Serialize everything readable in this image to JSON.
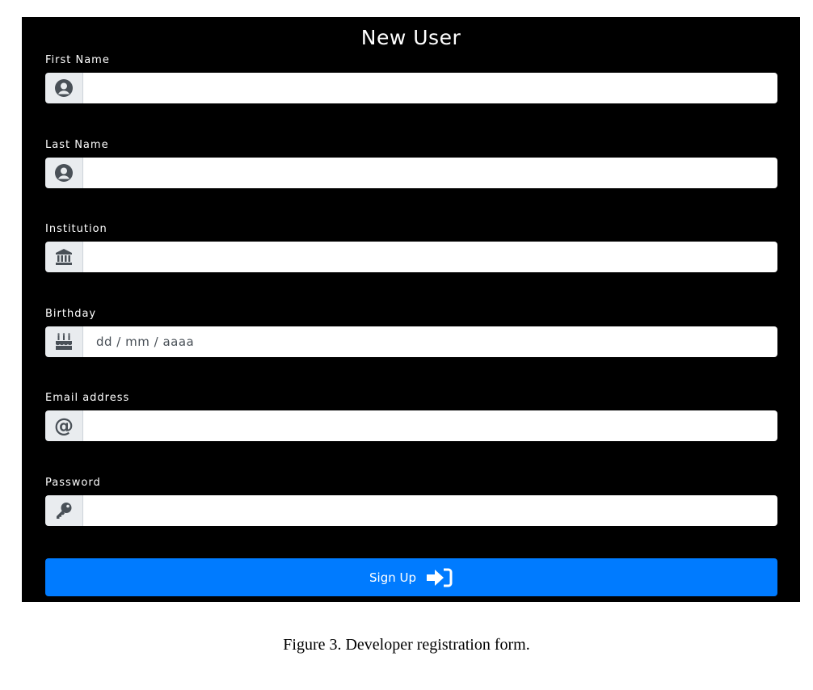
{
  "form": {
    "title": "New User",
    "fields": [
      {
        "label": "First Name",
        "icon": "user-circle-icon",
        "value": ""
      },
      {
        "label": "Last Name",
        "icon": "user-circle-icon",
        "value": ""
      },
      {
        "label": "Institution",
        "icon": "university-icon",
        "value": ""
      },
      {
        "label": "Birthday",
        "icon": "birthday-cake-icon",
        "value": "",
        "display": "dd / mm / aaaa"
      },
      {
        "label": "Email address",
        "icon": "at-icon",
        "value": ""
      },
      {
        "label": "Password",
        "icon": "key-icon",
        "value": ""
      }
    ],
    "submit_label": "Sign Up",
    "submit_icon": "sign-in-icon"
  },
  "colors": {
    "panel_background": "#000000",
    "button": "#007bff",
    "addon_background": "#e9ecef",
    "icon": "#495057"
  },
  "caption": "Figure 3. Developer registration form."
}
